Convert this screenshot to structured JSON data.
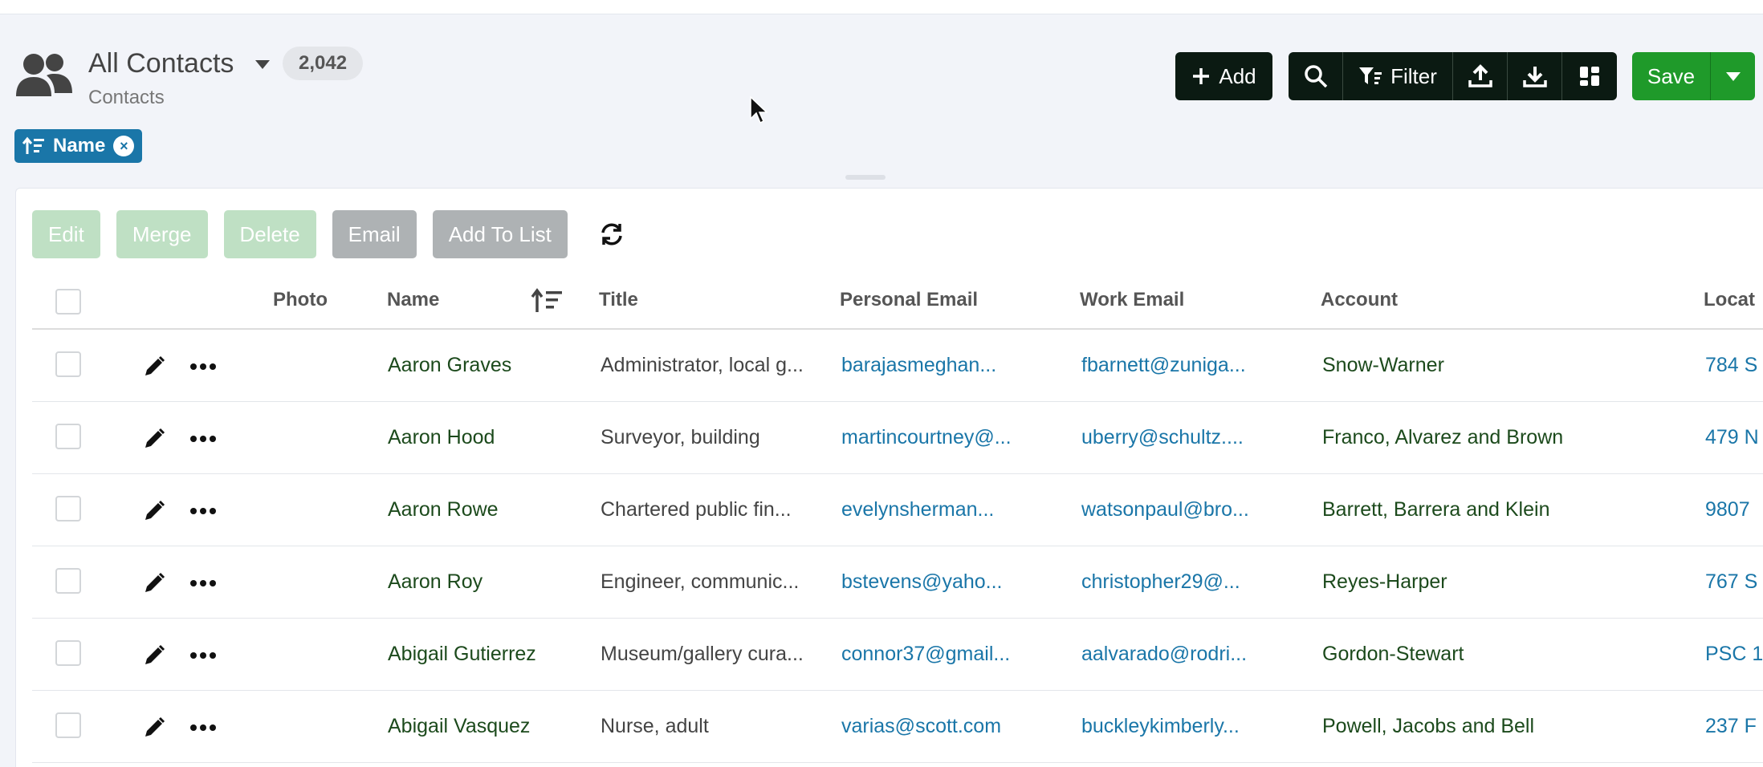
{
  "header": {
    "title": "All Contacts",
    "count": "2,042",
    "subtitle": "Contacts",
    "icon": "users-icon"
  },
  "sort_chip": {
    "label": "Name",
    "close": "×"
  },
  "toolbar": {
    "add_label": "Add",
    "filter_label": "Filter",
    "save_label": "Save"
  },
  "actions": {
    "edit": "Edit",
    "merge": "Merge",
    "delete": "Delete",
    "email": "Email",
    "add_to_list": "Add To List"
  },
  "columns": {
    "photo": "Photo",
    "name": "Name",
    "title": "Title",
    "personal_email": "Personal Email",
    "work_email": "Work Email",
    "account": "Account",
    "location": "Locat"
  },
  "rows": [
    {
      "name": "Aaron Graves",
      "title": "Administrator, local g...",
      "personal_email": "barajasmeghan...",
      "work_email": "fbarnett@zuniga...",
      "account": "Snow-Warner",
      "location": "784 S"
    },
    {
      "name": "Aaron Hood",
      "title": "Surveyor, building",
      "personal_email": "martincourtney@...",
      "work_email": "uberry@schultz....",
      "account": "Franco, Alvarez and Brown",
      "location": "479 N"
    },
    {
      "name": "Aaron Rowe",
      "title": "Chartered public fin...",
      "personal_email": "evelynsherman...",
      "work_email": "watsonpaul@bro...",
      "account": "Barrett, Barrera and Klein",
      "location": "9807"
    },
    {
      "name": "Aaron Roy",
      "title": "Engineer, communic...",
      "personal_email": "bstevens@yaho...",
      "work_email": "christopher29@...",
      "account": "Reyes-Harper",
      "location": "767 S"
    },
    {
      "name": "Abigail Gutierrez",
      "title": "Museum/gallery cura...",
      "personal_email": "connor37@gmail...",
      "work_email": "aalvarado@rodri...",
      "account": "Gordon-Stewart",
      "location": "PSC 1"
    },
    {
      "name": "Abigail Vasquez",
      "title": "Nurse, adult",
      "personal_email": "varias@scott.com",
      "work_email": "buckleykimberly...",
      "account": "Powell, Jacobs and Bell",
      "location": "237 F"
    }
  ],
  "colors": {
    "dark": "#0b1a12",
    "green": "#1f9a2a",
    "accent": "#1a76a8",
    "name_text": "#1c4a1c"
  }
}
